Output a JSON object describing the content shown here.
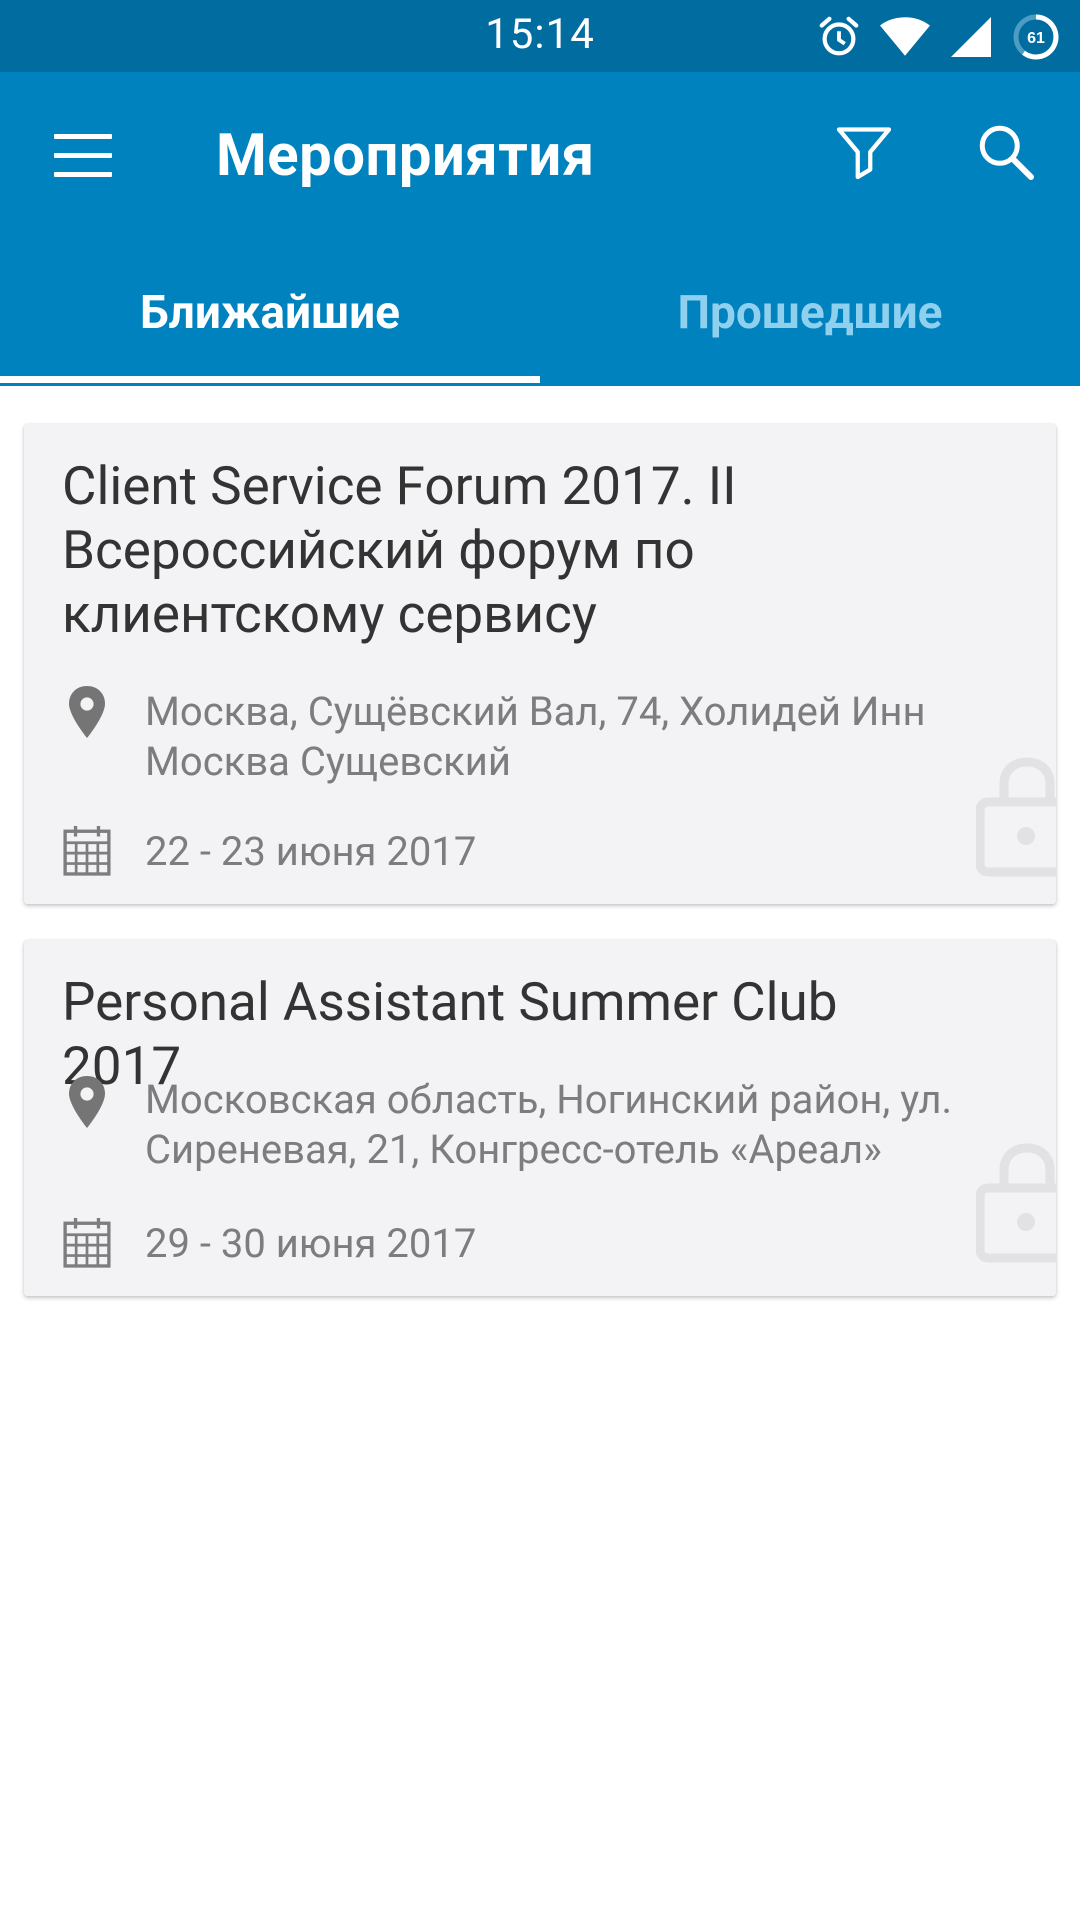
{
  "status_bar": {
    "time": "15:14",
    "battery_level": "61",
    "icons": [
      "alarm-icon",
      "wifi-icon",
      "signal-icon",
      "battery-icon"
    ]
  },
  "app_bar": {
    "title": "Мероприятия",
    "menu_icon": "hamburger-menu-icon",
    "filter_icon": "filter-icon",
    "search_icon": "search-icon",
    "background_color": "#0082be",
    "status_color": "#016c9f"
  },
  "tabs": [
    {
      "label": "Ближайшие",
      "selected": true
    },
    {
      "label": "Прошедшие",
      "selected": false
    }
  ],
  "events": [
    {
      "title": "Client Service Forum 2017. II Всероссийский форум по клиентскому сервису",
      "location": "Москва, Сущёвский Вал, 74, Холидей Инн Москва Сущевский",
      "dates": "22 - 23 июня 2017",
      "location_icon": "map-pin-icon",
      "date_icon": "calendar-icon",
      "badge_icon": "lock-icon"
    },
    {
      "title": "Personal Assistant Summer Club 2017",
      "location": "Московская область, Ногинский район, ул. Сиреневая, 21, Конгресс-отель «Ареал»",
      "dates": "29 - 30 июня 2017",
      "location_icon": "map-pin-icon",
      "date_icon": "calendar-icon",
      "badge_icon": "lock-icon"
    }
  ]
}
